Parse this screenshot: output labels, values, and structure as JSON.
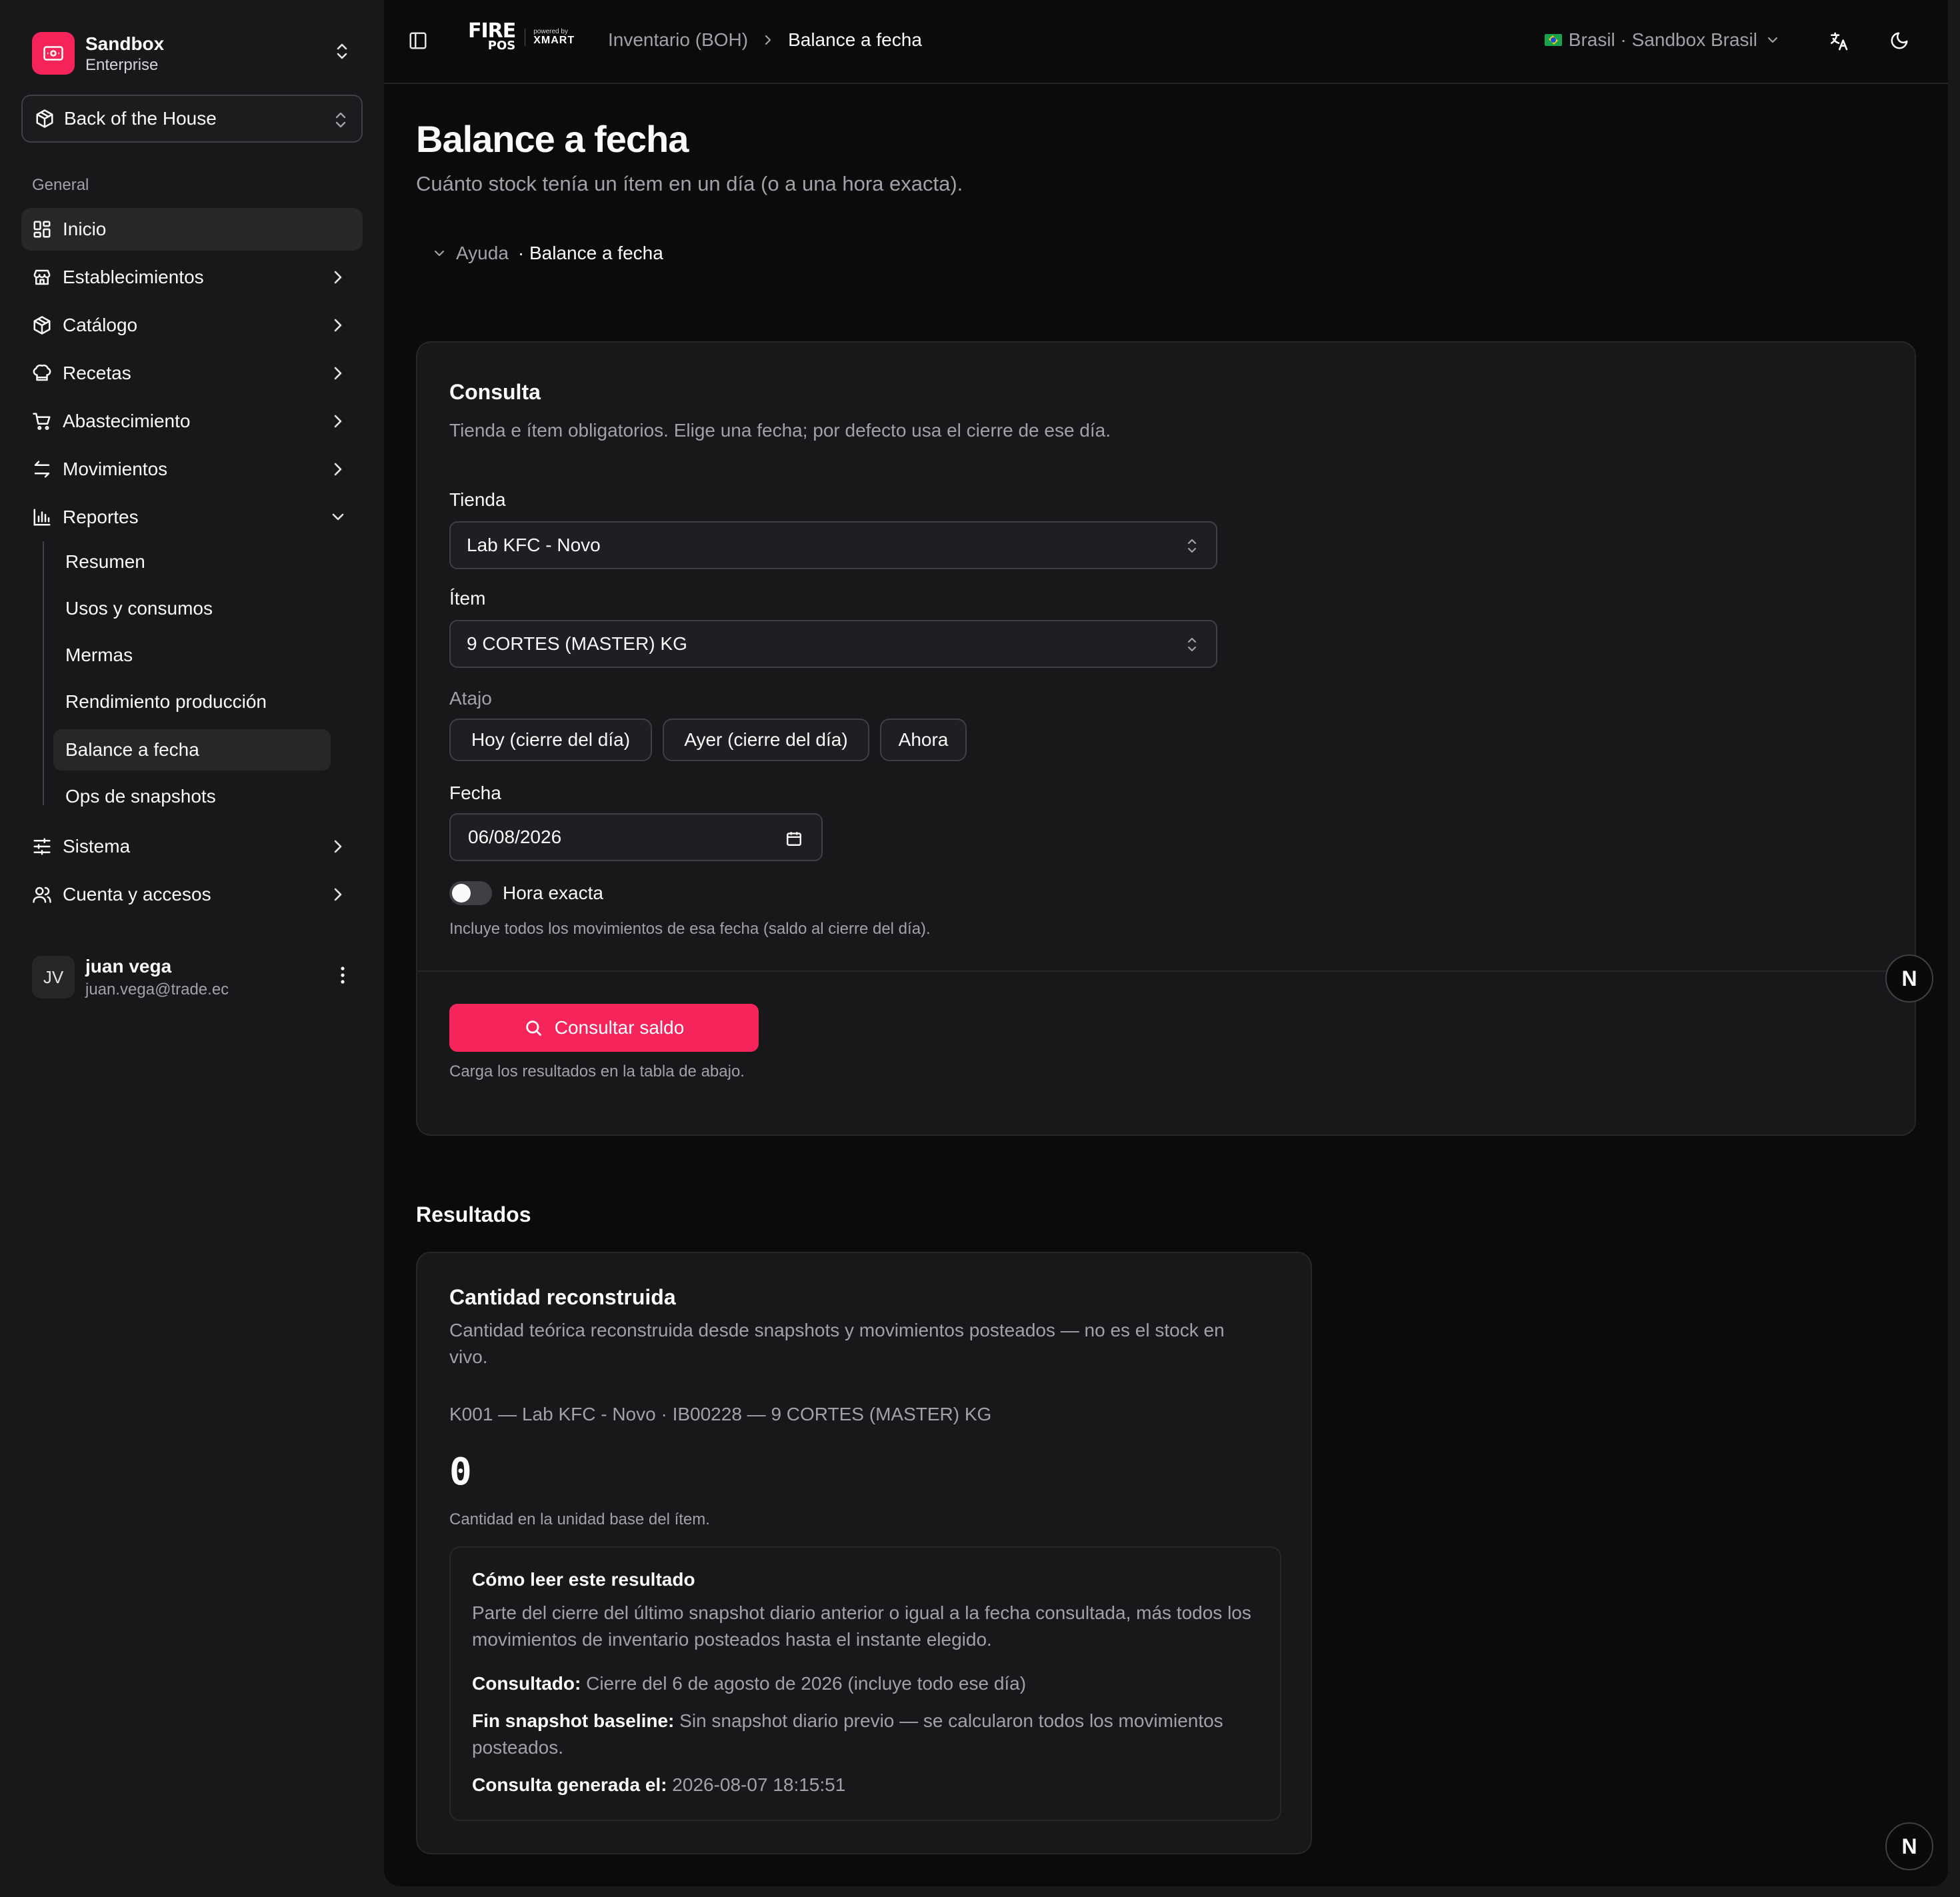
{
  "team": {
    "name": "Sandbox",
    "plan": "Enterprise"
  },
  "context_selector": {
    "label": "Back of the House"
  },
  "sidebar": {
    "group_label": "General",
    "items": [
      {
        "label": "Inicio",
        "icon": "dashboard-icon",
        "active": true
      },
      {
        "label": "Establecimientos",
        "icon": "store-icon"
      },
      {
        "label": "Catálogo",
        "icon": "package-icon"
      },
      {
        "label": "Recetas",
        "icon": "chef-hat-icon"
      },
      {
        "label": "Abastecimiento",
        "icon": "cart-icon"
      },
      {
        "label": "Movimientos",
        "icon": "arrows-exchange-icon"
      },
      {
        "label": "Reportes",
        "icon": "bar-chart-icon",
        "expanded": true
      },
      {
        "label": "Sistema",
        "icon": "sliders-icon"
      },
      {
        "label": "Cuenta y accesos",
        "icon": "users-icon"
      }
    ],
    "reportes_sub": [
      {
        "label": "Resumen"
      },
      {
        "label": "Usos y consumos"
      },
      {
        "label": "Mermas"
      },
      {
        "label": "Rendimiento producción"
      },
      {
        "label": "Balance a fecha",
        "active": true
      },
      {
        "label": "Ops de snapshots"
      }
    ]
  },
  "user": {
    "initials": "JV",
    "name": "juan vega",
    "email": "juan.vega@trade.ec"
  },
  "topbar": {
    "brand_fire": "FIRE",
    "brand_pos": "POS",
    "brand_powered": "powered by",
    "brand_xmart": "XMART",
    "breadcrumb": [
      "Inventario (BOH)",
      "Balance a fecha"
    ],
    "region": "Brasil · Sandbox Brasil"
  },
  "page": {
    "title": "Balance a fecha",
    "subtitle": "Cuánto stock tenía un ítem en un día (o a una hora exacta).",
    "help_label": "Ayuda",
    "help_topic": "· Balance a fecha"
  },
  "query_card": {
    "title": "Consulta",
    "description": "Tienda e ítem obligatorios. Elige una fecha; por defecto usa el cierre de ese día.",
    "store_label": "Tienda",
    "store_value": "Lab KFC - Novo",
    "item_label": "Ítem",
    "item_value": "9 CORTES (MASTER) KG",
    "shortcut_label": "Atajo",
    "shortcuts": [
      "Hoy (cierre del día)",
      "Ayer (cierre del día)",
      "Ahora"
    ],
    "date_label": "Fecha",
    "date_value": "06/08/2026",
    "exact_time_label": "Hora exacta",
    "exact_time_on": false,
    "exact_time_hint": "Incluye todos los movimientos de esa fecha (saldo al cierre del día).",
    "submit_label": "Consultar saldo",
    "submit_hint": "Carga los resultados en la tabla de abajo."
  },
  "results": {
    "heading": "Resultados",
    "title": "Cantidad reconstruida",
    "description": "Cantidad teórica reconstruida desde snapshots y movimientos posteados — no es el stock en vivo.",
    "identifier": "K001 — Lab KFC - Novo · IB00228 — 9 CORTES (MASTER) KG",
    "quantity": "0",
    "quantity_hint": "Cantidad en la unidad base del ítem.",
    "explain_title": "Cómo leer este resultado",
    "explain_text": "Parte del cierre del último snapshot diario anterior o igual a la fecha consultada, más todos los movimientos de inventario posteados hasta el instante elegido.",
    "consulted_label": "Consultado:",
    "consulted_value": "Cierre del 6 de agosto de 2026 (incluye todo ese día)",
    "baseline_label": "Fin snapshot baseline:",
    "baseline_value": "Sin snapshot diario previo — se calcularon todos los movimientos posteados.",
    "generated_label": "Consulta generada el:",
    "generated_value": "2026-08-07 18:15:51"
  },
  "badge": {
    "letter": "N"
  },
  "colors": {
    "accent": "#f5245a",
    "background": "#0b0b0c",
    "sidebar": "#18181b",
    "card": "#18181b"
  }
}
